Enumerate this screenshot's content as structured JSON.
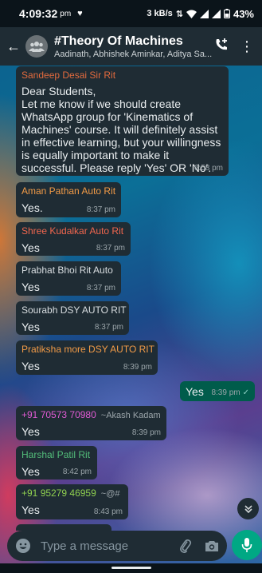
{
  "status_bar": {
    "time": "4:09:32",
    "ampm": "pm",
    "net_speed": "3 kB/s",
    "battery": "43%"
  },
  "header": {
    "title": "#Theory Of Machines",
    "subtitle": "Aadinath, Abhishek Aminkar, Aditya Sa..."
  },
  "messages": [
    {
      "sender": "Sandeep Desai Sir Rit",
      "sender_color": "#e26a3d",
      "text": "Dear Students,\nLet me know if we should create WhatsApp group for 'Kinematics of Machines' course. It will definitely assist in effective learning, but your willingness is equally important to make it successful. Please reply 'Yes' OR 'No'.",
      "time": "6:58 pm"
    },
    {
      "sender": "Aman Pathan Auto Rit",
      "sender_color": "#f29b47",
      "text": "Yes.",
      "time": "8:37 pm"
    },
    {
      "sender": "Shree Kudalkar Auto Rit",
      "sender_color": "#f0664e",
      "text": "Yes",
      "time": "8:37 pm"
    },
    {
      "sender": "Prabhat Bhoi Rit Auto",
      "sender_color": "#d9dee1",
      "text": "Yes",
      "time": "8:37 pm"
    },
    {
      "sender": "Sourabh DSY AUTO RIT",
      "sender_color": "#d9dee1",
      "text": "Yes",
      "time": "8:37 pm"
    },
    {
      "sender": "Pratiksha more DSY AUTO RIT",
      "sender_color": "#f29b47",
      "text": "Yes",
      "time": "8:39 pm"
    },
    {
      "text": "Yes",
      "time": "8:39 pm",
      "tick": "✓"
    },
    {
      "sender": "+91 70573 70980",
      "pushname": "~Akash Kadam",
      "sender_color": "#e05bd4",
      "text": "Yes",
      "time": "8:39 pm"
    },
    {
      "sender": "Harshal Patil Rit",
      "sender_color": "#53bd7a",
      "text": "Yes",
      "time": "8:42 pm"
    },
    {
      "sender": "+91 95279 46959",
      "pushname": "~@#",
      "sender_color": "#8fd04f",
      "text": "Yes",
      "time": "8:43 pm"
    }
  ],
  "composer": {
    "placeholder": "Type a message"
  },
  "colors": {
    "bubble_in": "#1f2c34",
    "bubble_out": "#005c4b",
    "accent": "#00a884"
  }
}
